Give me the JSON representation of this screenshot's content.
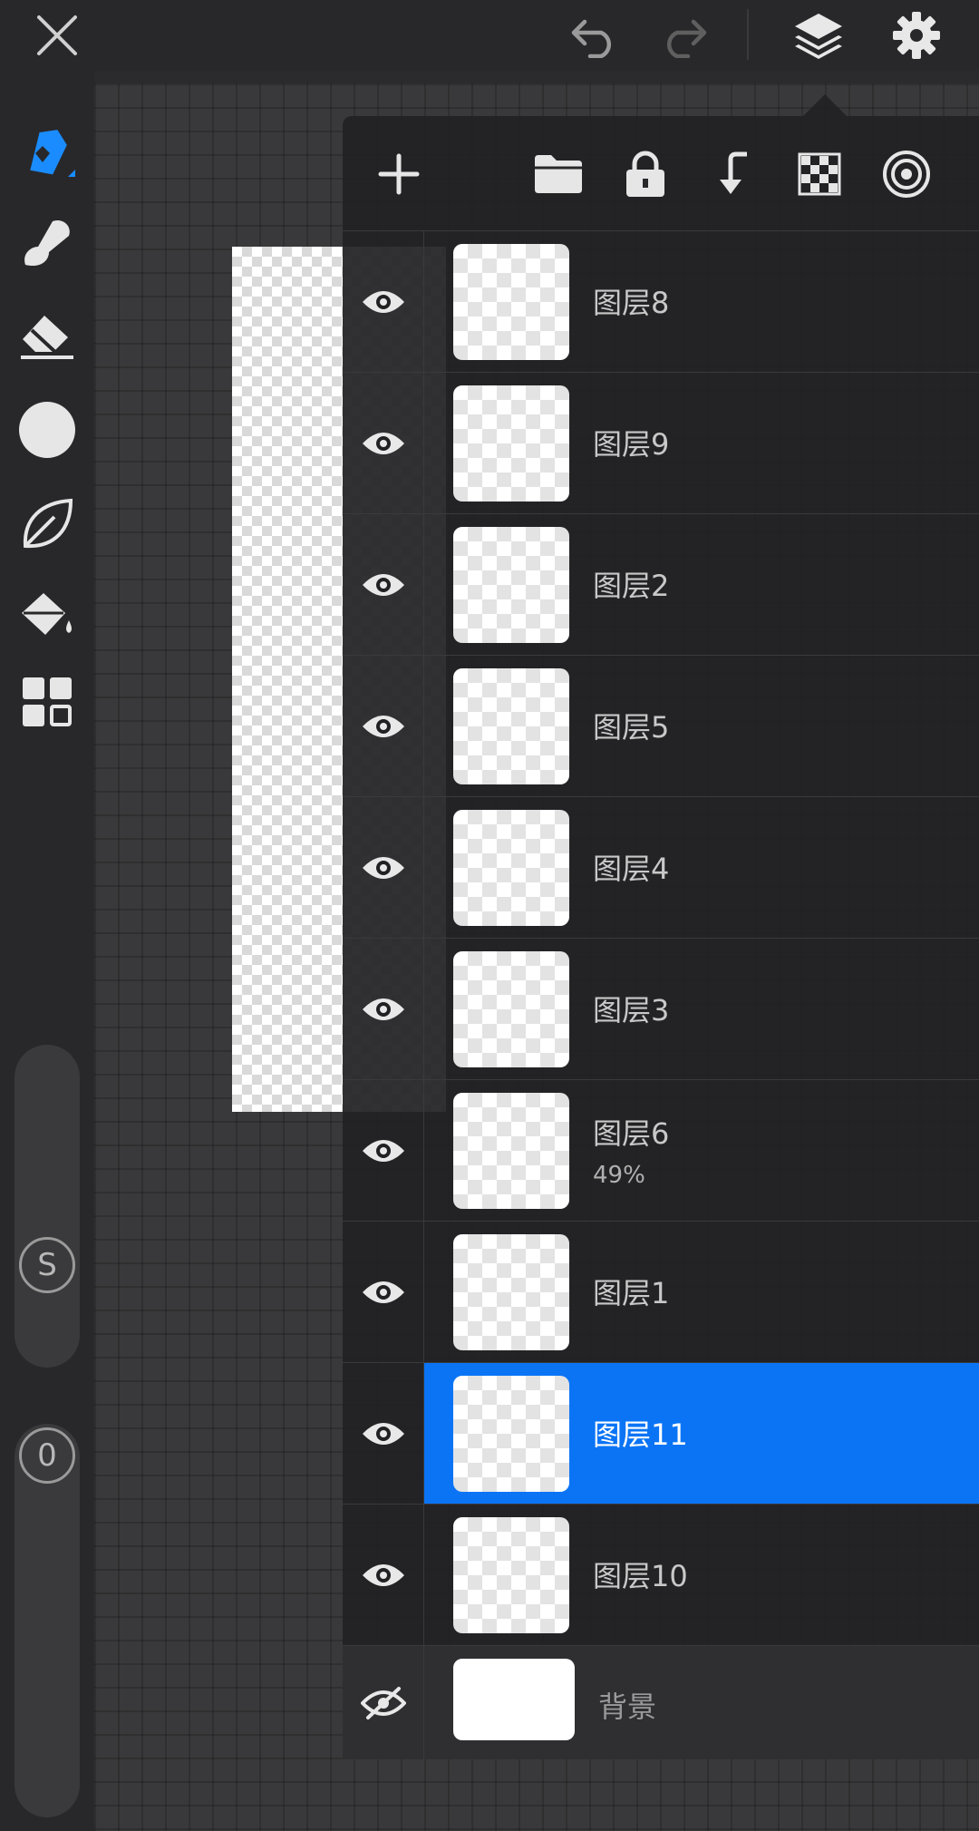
{
  "topbar": {
    "close_icon": "close-icon",
    "undo_icon": "undo-icon",
    "redo_icon": "redo-icon",
    "layers_icon": "layers-icon",
    "settings_icon": "gear-icon"
  },
  "toolbar": {
    "tools": [
      "pen-tool-icon",
      "smudge-tool-icon",
      "eraser-tool-icon",
      "color-circle-icon",
      "leaf-shape-icon",
      "fill-bucket-icon",
      "grid-menu-icon"
    ],
    "active_tool": "pen-tool-icon",
    "accent_color": "#1a8cff",
    "size_label": "S",
    "opacity_label": "0"
  },
  "panel": {
    "toolbar_icons": [
      "add-icon",
      "folder-icon",
      "lock-icon",
      "merge-down-icon",
      "transparency-icon",
      "target-icon"
    ],
    "selected_color": "#0a74f5",
    "layers": [
      {
        "name": "图层8",
        "visible": true
      },
      {
        "name": "图层9",
        "visible": true
      },
      {
        "name": "图层2",
        "visible": true
      },
      {
        "name": "图层5",
        "visible": true
      },
      {
        "name": "图层4",
        "visible": true
      },
      {
        "name": "图层3",
        "visible": true
      },
      {
        "name": "图层6",
        "opacity": "49%",
        "visible": true
      },
      {
        "name": "图层1",
        "visible": true
      },
      {
        "name": "图层11",
        "visible": true,
        "selected": true
      },
      {
        "name": "图层10",
        "visible": true
      }
    ],
    "background": {
      "name": "背景",
      "visible": false
    }
  }
}
